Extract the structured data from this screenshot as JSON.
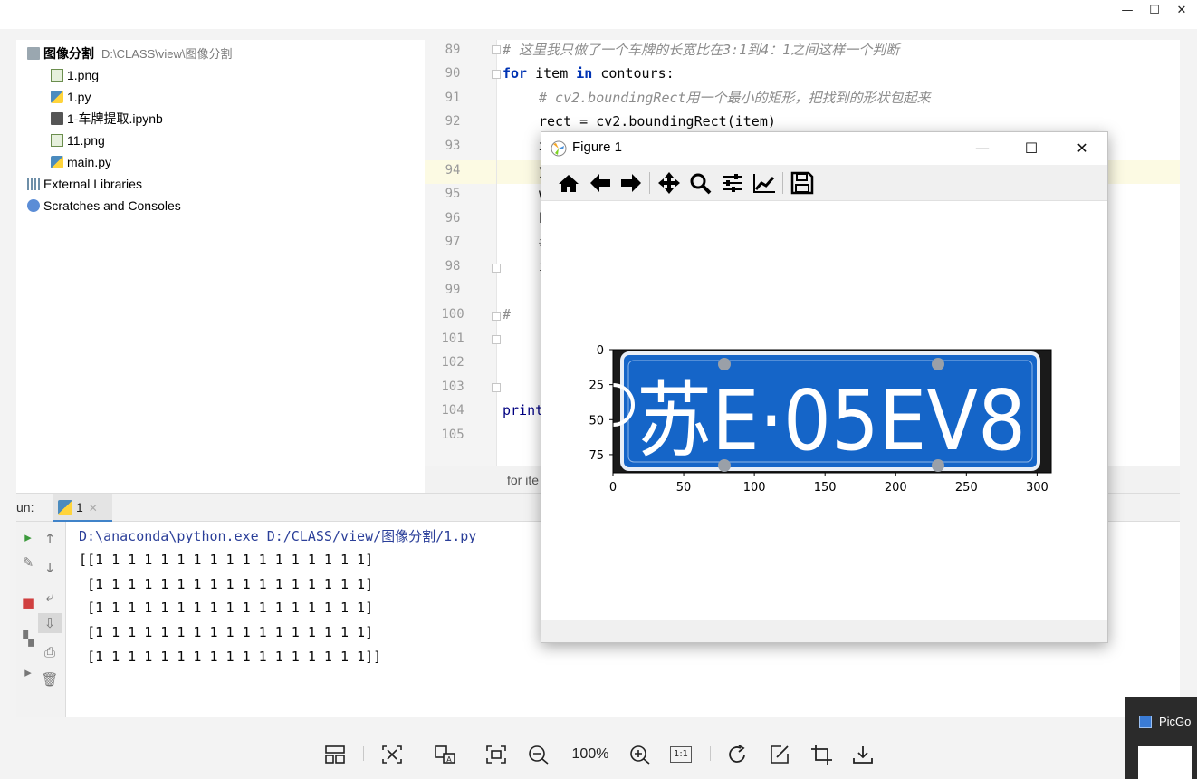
{
  "viewer": {
    "controls": {
      "minimize": "—",
      "maximize": "☐",
      "close": "✕"
    },
    "toolbar": {
      "zoom_level": "100%",
      "actual_size": "1:1",
      "icons": [
        "layout-icon",
        "fit-icon",
        "ocr-icon",
        "fullscreen-icon",
        "zoom-out-icon",
        "zoom-in-icon",
        "actual-size-icon",
        "rotate-icon",
        "edit-icon",
        "crop-icon",
        "download-icon"
      ]
    }
  },
  "project": {
    "root_name": "图像分割",
    "root_path": "D:\\CLASS\\view\\图像分割",
    "files": [
      {
        "name": "1.png",
        "type": "png"
      },
      {
        "name": "1.py",
        "type": "py"
      },
      {
        "name": "1-车牌提取.ipynb",
        "type": "ipynb"
      },
      {
        "name": "11.png",
        "type": "png"
      },
      {
        "name": "main.py",
        "type": "py"
      }
    ],
    "external": "External Libraries",
    "scratches": "Scratches and Consoles"
  },
  "editor": {
    "line_numbers": [
      "89",
      "90",
      "91",
      "92",
      "93",
      "94",
      "95",
      "96",
      "97",
      "98",
      "99",
      "100",
      "101",
      "102",
      "103",
      "104",
      "105"
    ],
    "lines": {
      "l89": "# 这里我只做了一个车牌的长宽比在3:1到4：1之间这样一个判断",
      "l90_kw1": "for",
      "l90_mid": " item ",
      "l90_kw2": "in",
      "l90_end": " contours:",
      "l91": "# cv2.boundingRect用一个最小的矩形，把找到的形状包起来",
      "l92": "rect = cv2.boundingRect(item)",
      "l93": "x",
      "l94": "y",
      "l95": "w",
      "l96": "h",
      "l97": "#",
      "l98": "i",
      "l100": "#",
      "l104": "print"
    },
    "breadcrumb": "for ite"
  },
  "run": {
    "label": "un:",
    "tab_label": "1",
    "tab_close": "✕",
    "command": "D:\\anaconda\\python.exe D:/CLASS/view/图像分割/1.py",
    "output": [
      "[[1 1 1 1 1 1 1 1 1 1 1 1 1 1 1 1 1]",
      " [1 1 1 1 1 1 1 1 1 1 1 1 1 1 1 1 1]",
      " [1 1 1 1 1 1 1 1 1 1 1 1 1 1 1 1 1]",
      " [1 1 1 1 1 1 1 1 1 1 1 1 1 1 1 1 1]",
      " [1 1 1 1 1 1 1 1 1 1 1 1 1 1 1 1 1]]"
    ]
  },
  "figure": {
    "title": "Figure 1",
    "controls": {
      "minimize": "—",
      "maximize": "☐",
      "close": "✕"
    },
    "toolbar_icons": [
      "home-icon",
      "back-icon",
      "forward-icon",
      "pan-icon",
      "zoom-icon",
      "configure-icon",
      "edit-axis-icon",
      "save-icon"
    ],
    "plate_text": "苏E·05EV8",
    "colors": {
      "plate_blue": "#1565c8",
      "plate_border": "#ffffff"
    }
  },
  "chart_data": {
    "type": "image",
    "title": "",
    "xlabel": "",
    "ylabel": "",
    "xlim": [
      0,
      310
    ],
    "ylim": [
      88,
      0
    ],
    "xticks": [
      0,
      50,
      100,
      150,
      200,
      250,
      300
    ],
    "yticks": [
      0,
      25,
      50,
      75
    ],
    "content": "license plate crop"
  },
  "picgo": {
    "label": "PicGo"
  }
}
